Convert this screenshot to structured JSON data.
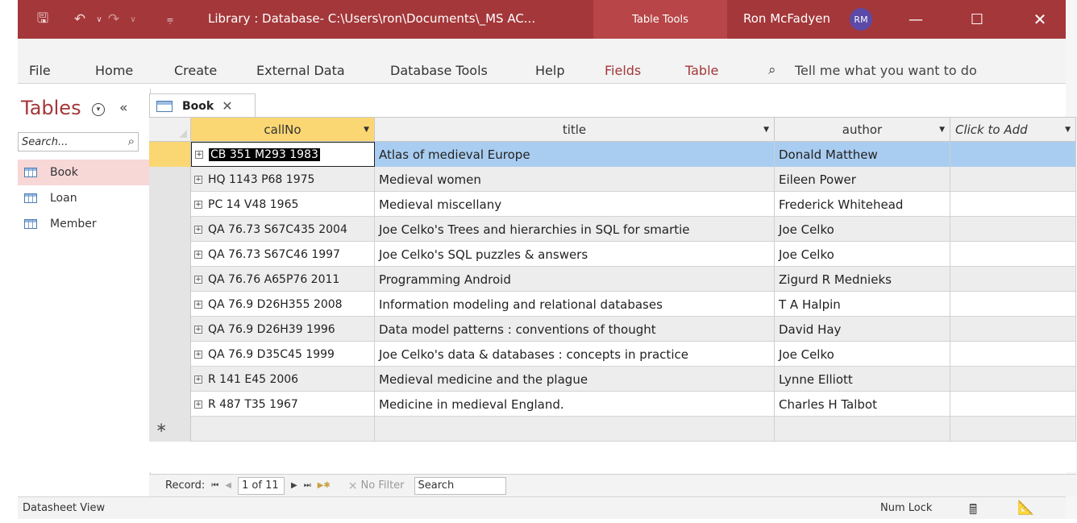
{
  "titlebar": {
    "title": "Library : Database- C:\\Users\\ron\\Documents\\_MS AC...",
    "context": "Table Tools",
    "user": "Ron McFadyen",
    "initials": "RM"
  },
  "ribbon": {
    "tabs": [
      "File",
      "Home",
      "Create",
      "External Data",
      "Database Tools",
      "Help",
      "Fields",
      "Table"
    ],
    "tell_me": "Tell me what you want to do"
  },
  "nav": {
    "title": "Tables",
    "search_placeholder": "Search...",
    "items": [
      "Book",
      "Loan",
      "Member"
    ],
    "selected": "Book"
  },
  "doc_tab": {
    "label": "Book"
  },
  "grid": {
    "columns": [
      "callNo",
      "title",
      "author",
      "Click to Add"
    ],
    "rows": [
      {
        "callNo": "CB 351 M293 1983",
        "title": "Atlas of medieval Europe",
        "author": "Donald Matthew"
      },
      {
        "callNo": "HQ 1143 P68 1975",
        "title": "Medieval women",
        "author": "Eileen Power"
      },
      {
        "callNo": "PC 14 V48 1965",
        "title": "Medieval miscellany",
        "author": "Frederick Whitehead"
      },
      {
        "callNo": "QA 76.73 S67C435 2004",
        "title": "Joe Celko's Trees and hierarchies in SQL for smartie",
        "author": "Joe Celko"
      },
      {
        "callNo": "QA 76.73 S67C46 1997",
        "title": "Joe Celko's SQL puzzles & answers",
        "author": "Joe Celko"
      },
      {
        "callNo": "QA 76.76 A65P76 2011",
        "title": "Programming Android",
        "author": "Zigurd R Mednieks"
      },
      {
        "callNo": "QA 76.9 D26H355 2008",
        "title": "Information modeling and relational databases",
        "author": "T A Halpin"
      },
      {
        "callNo": "QA 76.9 D26H39 1996",
        "title": "Data model patterns : conventions of thought",
        "author": "David Hay"
      },
      {
        "callNo": "QA 76.9 D35C45 1999",
        "title": "Joe Celko's data & databases : concepts in practice",
        "author": "Joe Celko"
      },
      {
        "callNo": "R 141 E45 2006",
        "title": "Medieval medicine and the plague",
        "author": "Lynne Elliott"
      },
      {
        "callNo": "R 487 T35 1967",
        "title": "Medicine in medieval England.",
        "author": "Charles H Talbot"
      }
    ]
  },
  "record_nav": {
    "label": "Record:",
    "current": "1 of 11",
    "no_filter": "No Filter",
    "search": "Search"
  },
  "status": {
    "view": "Datasheet View",
    "num_lock": "Num Lock"
  },
  "colors": {
    "accent": "#a4373a",
    "selected_row": "#a9cdf0",
    "selected_header": "#fbd774"
  }
}
